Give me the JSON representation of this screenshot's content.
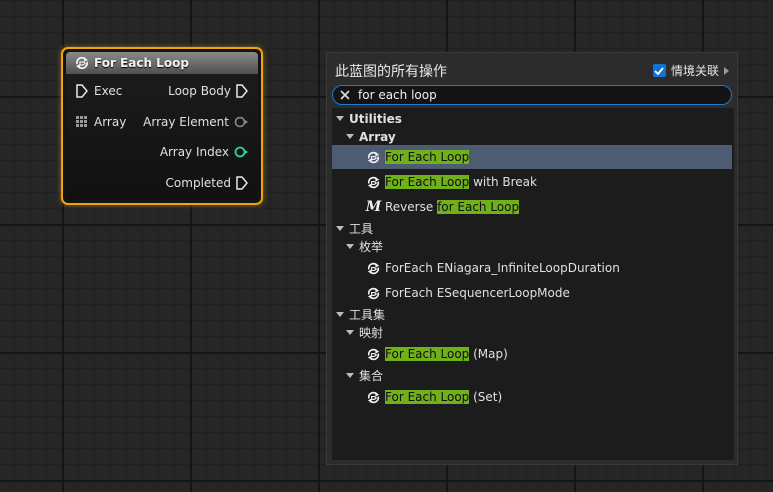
{
  "node": {
    "title": "For Each Loop",
    "pins": {
      "exec": "Exec",
      "loop_body": "Loop Body",
      "array": "Array",
      "array_element": "Array Element",
      "array_index": "Array Index",
      "completed": "Completed"
    },
    "colors": {
      "border": "#f2a20b",
      "index_pin": "#2ecfa0"
    }
  },
  "menu": {
    "title": "此蓝图的所有操作",
    "context_label": "情境关联",
    "context_checked": true,
    "search_value": "for each loop",
    "groups": [
      {
        "label": "Utilities",
        "subgroups": [
          {
            "label": "Array",
            "items": [
              {
                "highlight": "For Each Loop",
                "rest": "",
                "selected": true,
                "icon": "loop-icon"
              },
              {
                "highlight": "For Each Loop",
                "rest": " with Break",
                "icon": "loop-icon"
              },
              {
                "prefix": "Reverse ",
                "highlight": "for Each Loop",
                "icon": "macro-icon"
              }
            ]
          }
        ]
      },
      {
        "label": "工具",
        "subgroups": [
          {
            "label": "枚举",
            "items": [
              {
                "text": "ForEach ENiagara_InfiniteLoopDuration",
                "icon": "loop-icon"
              },
              {
                "text": "ForEach ESequencerLoopMode",
                "icon": "loop-icon"
              }
            ]
          }
        ]
      },
      {
        "label": "工具集",
        "subgroups": [
          {
            "label": "映射",
            "items": [
              {
                "highlight": "For Each Loop",
                "rest": " (Map)",
                "icon": "loop-icon"
              }
            ]
          },
          {
            "label": "集合",
            "items": [
              {
                "highlight": "For Each Loop",
                "rest": " (Set)",
                "icon": "loop-icon"
              }
            ]
          }
        ]
      }
    ],
    "colors": {
      "highlight": "#70b01a",
      "selected_row": "#4d5c73",
      "search_border": "#1f7ad0"
    }
  }
}
